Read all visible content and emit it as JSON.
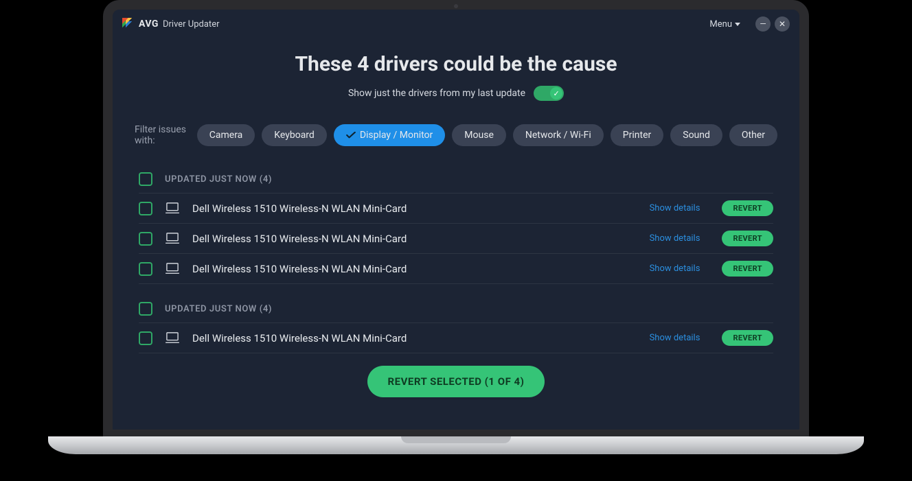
{
  "header": {
    "brand": "AVG",
    "product": "Driver Updater",
    "menu_label": "Menu"
  },
  "title": "These 4 drivers could be the cause",
  "toggle": {
    "label": "Show just the drivers from my last update",
    "on": true
  },
  "filters": {
    "label": "Filter issues with:",
    "items": [
      {
        "label": "Camera",
        "active": false
      },
      {
        "label": "Keyboard",
        "active": false
      },
      {
        "label": "Display / Monitor",
        "active": true
      },
      {
        "label": "Mouse",
        "active": false
      },
      {
        "label": "Network / Wi-Fi",
        "active": false
      },
      {
        "label": "Printer",
        "active": false
      },
      {
        "label": "Sound",
        "active": false
      },
      {
        "label": "Other",
        "active": false
      }
    ]
  },
  "groups": [
    {
      "header": "UPDATED JUST NOW (4)",
      "items": [
        {
          "name": "Dell Wireless 1510 Wireless-N WLAN Mini-Card",
          "details": "Show details",
          "action": "REVERT"
        },
        {
          "name": "Dell Wireless 1510 Wireless-N WLAN Mini-Card",
          "details": "Show details",
          "action": "REVERT"
        },
        {
          "name": "Dell Wireless 1510 Wireless-N WLAN Mini-Card",
          "details": "Show details",
          "action": "REVERT"
        }
      ]
    },
    {
      "header": "UPDATED JUST NOW (4)",
      "items": [
        {
          "name": "Dell Wireless 1510 Wireless-N WLAN Mini-Card",
          "details": "Show details",
          "action": "REVERT"
        }
      ]
    }
  ],
  "footer": {
    "primary_label": "REVERT SELECTED (1 OF 4)"
  }
}
